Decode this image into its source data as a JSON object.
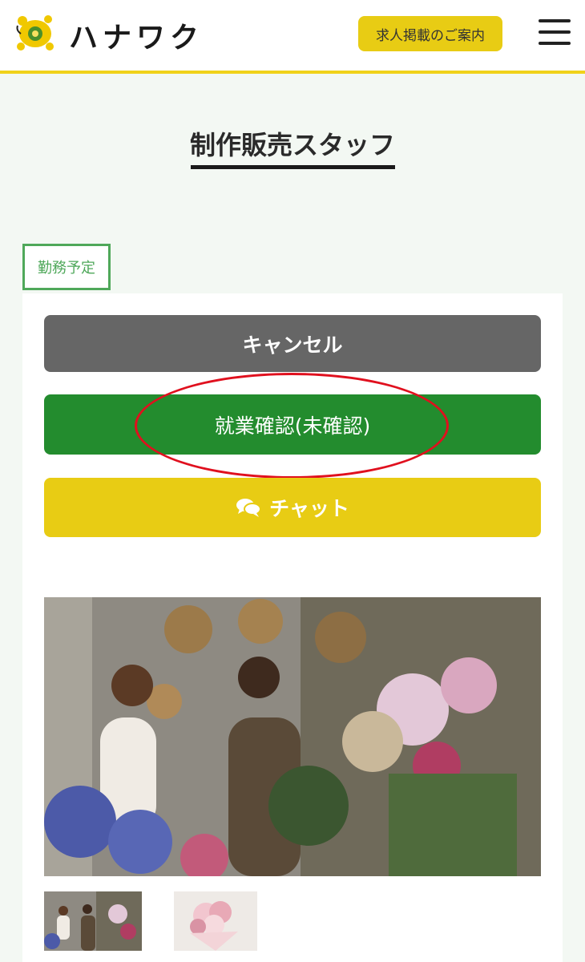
{
  "header": {
    "logo_text": "ハナワク",
    "logo_icon": "turtle-flower-logo",
    "recruit_label": "求人掲載のご案内",
    "menu_icon": "hamburger-icon"
  },
  "page": {
    "title": "制作販売スタッフ",
    "status_badge": "勤務予定"
  },
  "actions": {
    "cancel_label": "キャンセル",
    "confirm_label": "就業確認(未確認)",
    "chat_label": "チャット",
    "chat_icon": "chat-bubbles-icon"
  },
  "colors": {
    "accent_yellow": "#e8cc14",
    "confirm_green": "#238c2e",
    "cancel_gray": "#666666",
    "badge_green": "#4fa85a",
    "highlight_red": "#e0101e"
  },
  "gallery": {
    "main_image": "florists-arranging-flowers-photo",
    "thumbnails": [
      "florists-thumbnail",
      "bouquet-thumbnail"
    ]
  }
}
